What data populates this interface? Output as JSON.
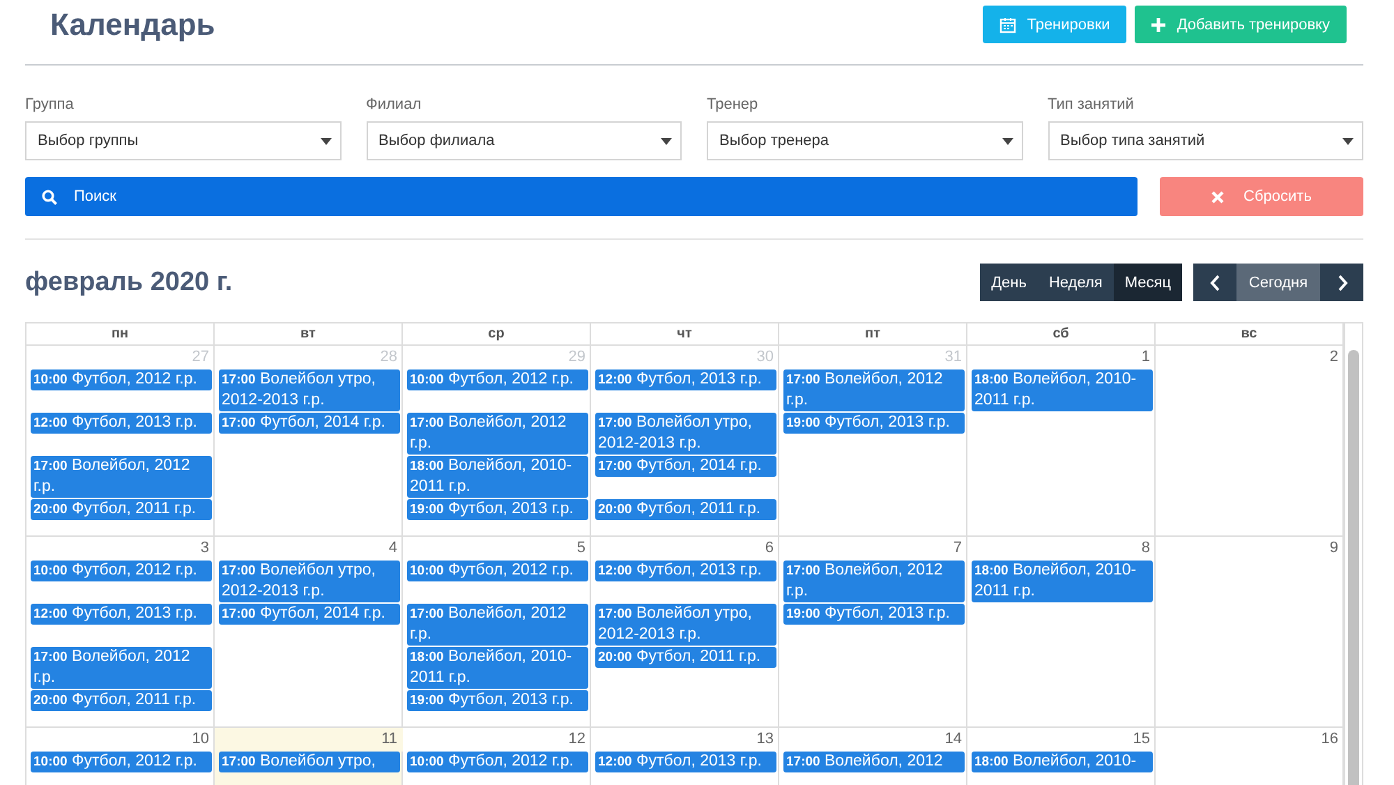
{
  "title": "Календарь",
  "top_buttons": [
    {
      "kind": "trainings",
      "label": "Тренировки"
    },
    {
      "kind": "add",
      "label": "Добавить тренировку"
    }
  ],
  "filters": [
    {
      "label": "Группа",
      "value": "Выбор группы"
    },
    {
      "label": "Филиал",
      "value": "Выбор филиала"
    },
    {
      "label": "Тренер",
      "value": "Выбор тренера"
    },
    {
      "label": "Тип занятий",
      "value": "Выбор типа занятий"
    }
  ],
  "search_button": "Поиск",
  "reset_button": "Сбросить",
  "month_title": "февраль 2020 г.",
  "views": [
    {
      "label": "День",
      "selected": false
    },
    {
      "label": "Неделя",
      "selected": false
    },
    {
      "label": "Месяц",
      "selected": true
    }
  ],
  "today_button": {
    "label": "Сегодня",
    "disabled": true
  },
  "weekdays": [
    "пн",
    "вт",
    "ср",
    "чт",
    "пт",
    "сб",
    "вс"
  ],
  "weeks": [
    {
      "days": [
        {
          "date": "27",
          "other_month": true,
          "today": false
        },
        {
          "date": "28",
          "other_month": true,
          "today": false
        },
        {
          "date": "29",
          "other_month": true,
          "today": false
        },
        {
          "date": "30",
          "other_month": true,
          "today": false
        },
        {
          "date": "31",
          "other_month": true,
          "today": false
        },
        {
          "date": "1",
          "other_month": false,
          "today": false
        },
        {
          "date": "2",
          "other_month": false,
          "today": false
        }
      ],
      "event_rows": [
        [
          {
            "time": "10:00",
            "title": "Футбол, 2012 г.р."
          },
          {
            "time": "17:00",
            "title": "Волейбол утро, 2012-2013 г.р."
          },
          {
            "time": "10:00",
            "title": "Футбол, 2012 г.р."
          },
          {
            "time": "12:00",
            "title": "Футбол, 2013 г.р."
          },
          {
            "time": "17:00",
            "title": "Волейбол, 2012 г.р."
          },
          {
            "time": "18:00",
            "title": "Волейбол, 2010-2011 г.р."
          },
          null
        ],
        [
          {
            "time": "12:00",
            "title": "Футбол, 2013 г.р."
          },
          {
            "time": "17:00",
            "title": "Футбол, 2014 г.р."
          },
          {
            "time": "17:00",
            "title": "Волейбол, 2012 г.р."
          },
          {
            "time": "17:00",
            "title": "Волейбол утро, 2012-2013 г.р."
          },
          {
            "time": "19:00",
            "title": "Футбол, 2013 г.р."
          },
          null,
          null
        ],
        [
          {
            "time": "17:00",
            "title": "Волейбол, 2012 г.р."
          },
          null,
          {
            "time": "18:00",
            "title": "Волейбол, 2010-2011 г.р."
          },
          {
            "time": "17:00",
            "title": "Футбол, 2014 г.р."
          },
          null,
          null,
          null
        ],
        [
          {
            "time": "20:00",
            "title": "Футбол, 2011 г.р."
          },
          null,
          {
            "time": "19:00",
            "title": "Футбол, 2013 г.р."
          },
          {
            "time": "20:00",
            "title": "Футбол, 2011 г.р."
          },
          null,
          null,
          null
        ]
      ]
    },
    {
      "days": [
        {
          "date": "3",
          "other_month": false,
          "today": false
        },
        {
          "date": "4",
          "other_month": false,
          "today": false
        },
        {
          "date": "5",
          "other_month": false,
          "today": false
        },
        {
          "date": "6",
          "other_month": false,
          "today": false
        },
        {
          "date": "7",
          "other_month": false,
          "today": false
        },
        {
          "date": "8",
          "other_month": false,
          "today": false
        },
        {
          "date": "9",
          "other_month": false,
          "today": false
        }
      ],
      "event_rows": [
        [
          {
            "time": "10:00",
            "title": "Футбол, 2012 г.р."
          },
          {
            "time": "17:00",
            "title": "Волейбол утро, 2012-2013 г.р."
          },
          {
            "time": "10:00",
            "title": "Футбол, 2012 г.р."
          },
          {
            "time": "12:00",
            "title": "Футбол, 2013 г.р."
          },
          {
            "time": "17:00",
            "title": "Волейбол, 2012 г.р."
          },
          {
            "time": "18:00",
            "title": "Волейбол, 2010-2011 г.р."
          },
          null
        ],
        [
          {
            "time": "12:00",
            "title": "Футбол, 2013 г.р."
          },
          {
            "time": "17:00",
            "title": "Футбол, 2014 г.р."
          },
          {
            "time": "17:00",
            "title": "Волейбол, 2012 г.р."
          },
          {
            "time": "17:00",
            "title": "Волейбол утро, 2012-2013 г.р."
          },
          {
            "time": "19:00",
            "title": "Футбол, 2013 г.р."
          },
          null,
          null
        ],
        [
          {
            "time": "17:00",
            "title": "Волейбол, 2012 г.р."
          },
          null,
          {
            "time": "18:00",
            "title": "Волейбол, 2010-2011 г.р."
          },
          {
            "time": "20:00",
            "title": "Футбол, 2011 г.р."
          },
          null,
          null,
          null
        ],
        [
          {
            "time": "20:00",
            "title": "Футбол, 2011 г.р."
          },
          null,
          {
            "time": "19:00",
            "title": "Футбол, 2013 г.р."
          },
          null,
          null,
          null,
          null
        ]
      ]
    },
    {
      "days": [
        {
          "date": "10",
          "other_month": false,
          "today": false
        },
        {
          "date": "11",
          "other_month": false,
          "today": true
        },
        {
          "date": "12",
          "other_month": false,
          "today": false
        },
        {
          "date": "13",
          "other_month": false,
          "today": false
        },
        {
          "date": "14",
          "other_month": false,
          "today": false
        },
        {
          "date": "15",
          "other_month": false,
          "today": false
        },
        {
          "date": "16",
          "other_month": false,
          "today": false
        }
      ],
      "event_rows": [
        [
          {
            "time": "10:00",
            "title": "Футбол, 2012 г.р."
          },
          {
            "time": "17:00",
            "title": "Волейбол утро,"
          },
          {
            "time": "10:00",
            "title": "Футбол, 2012 г.р."
          },
          {
            "time": "12:00",
            "title": "Футбол, 2013 г.р."
          },
          {
            "time": "17:00",
            "title": "Волейбол, 2012"
          },
          {
            "time": "18:00",
            "title": "Волейбол, 2010-"
          },
          null
        ]
      ]
    }
  ]
}
